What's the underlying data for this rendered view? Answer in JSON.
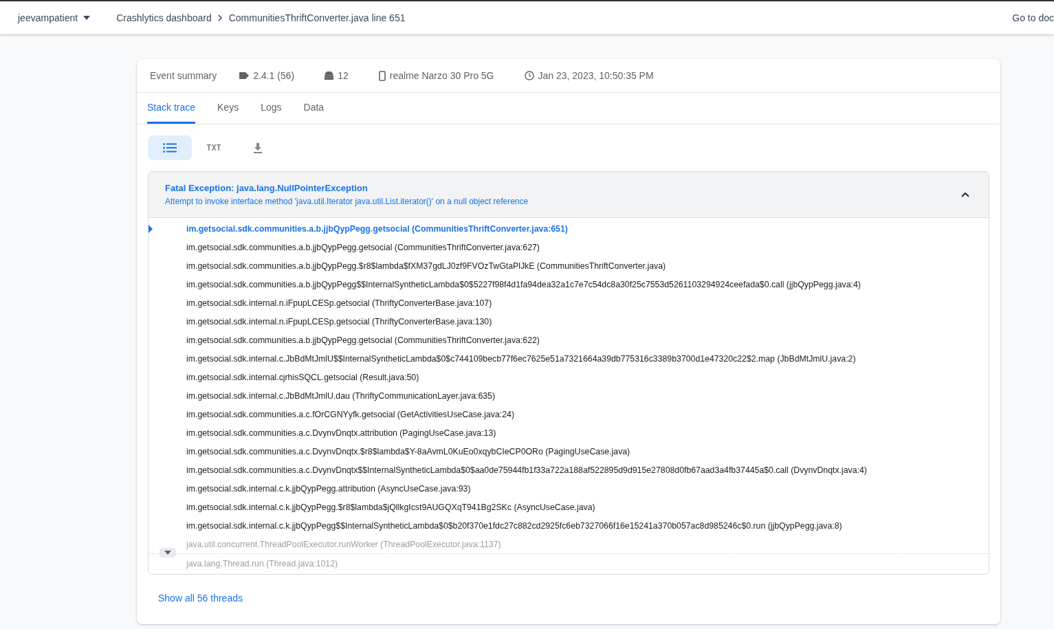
{
  "topbar": {
    "project": "jeevampatient",
    "breadcrumb": [
      "Crashlytics dashboard",
      "CommunitiesThriftConverter.java line 651"
    ],
    "docs_link": "Go to doc"
  },
  "summary": {
    "title": "Event summary",
    "version": "2.4.1 (56)",
    "android": "12",
    "device": "realme Narzo 30 Pro 5G",
    "time": "Jan 23, 2023, 10:50:35 PM"
  },
  "tabs": [
    {
      "label": "Stack trace",
      "selected": true
    },
    {
      "label": "Keys",
      "selected": false
    },
    {
      "label": "Logs",
      "selected": false
    },
    {
      "label": "Data",
      "selected": false
    }
  ],
  "view_options": [
    {
      "kind": "list",
      "selected": true
    },
    {
      "kind": "text",
      "label": "TXT",
      "selected": false
    },
    {
      "kind": "download",
      "selected": false
    }
  ],
  "exception": {
    "title": "Fatal Exception: java.lang.NullPointerException",
    "message": "Attempt to invoke interface method 'java.util.Iterator java.util.List.iterator()' on a null object reference",
    "expanded": true,
    "frames": [
      {
        "kind": "crash",
        "text": "im.getsocial.sdk.communities.a.b.jjbQypPegg.getsocial (CommunitiesThriftConverter.java:651)"
      },
      {
        "kind": "app",
        "text": "im.getsocial.sdk.communities.a.b.jjbQypPegg.getsocial (CommunitiesThriftConverter.java:627)"
      },
      {
        "kind": "app",
        "text": "im.getsocial.sdk.communities.a.b.jjbQypPegg.$r8$lambda$fXM37gdLJ0zf9FVOzTwGtaPlJkE (CommunitiesThriftConverter.java)"
      },
      {
        "kind": "app",
        "text": "im.getsocial.sdk.communities.a.b.jjbQypPegg$$InternalSyntheticLambda$0$5227f98f4d1fa94dea32a1c7e7c54dc8a30f25c7553d5261103294924ceefada$0.call (jjbQypPegg.java:4)"
      },
      {
        "kind": "app",
        "text": "im.getsocial.sdk.internal.n.iFpupLCESp.getsocial (ThriftyConverterBase.java:107)"
      },
      {
        "kind": "app",
        "text": "im.getsocial.sdk.internal.n.iFpupLCESp.getsocial (ThriftyConverterBase.java:130)"
      },
      {
        "kind": "app",
        "text": "im.getsocial.sdk.communities.a.b.jjbQypPegg.getsocial (CommunitiesThriftConverter.java:622)"
      },
      {
        "kind": "app",
        "text": "im.getsocial.sdk.internal.c.JbBdMtJmlU$$InternalSyntheticLambda$0$c744109becb77f6ec7625e51a7321664a39db775316c3389b3700d1e47320c22$2.map (JbBdMtJmlU.java:2)"
      },
      {
        "kind": "app",
        "text": "im.getsocial.sdk.internal.cjrhisSQCL.getsocial (Result.java:50)"
      },
      {
        "kind": "app",
        "text": "im.getsocial.sdk.internal.c.JbBdMtJmlU.dau (ThriftyCommunicationLayer.java:635)"
      },
      {
        "kind": "app",
        "text": "im.getsocial.sdk.communities.a.c.fOrCGNYyfk.getsocial (GetActivitiesUseCase.java:24)"
      },
      {
        "kind": "app",
        "text": "im.getsocial.sdk.communities.a.c.DvynvDnqtx.attribution (PagingUseCase.java:13)"
      },
      {
        "kind": "app",
        "text": "im.getsocial.sdk.communities.a.c.DvynvDnqtx.$r8$lambda$Y-8aAvmL0KuEo0xqybCIeCP0ORo (PagingUseCase.java)"
      },
      {
        "kind": "app",
        "text": "im.getsocial.sdk.communities.a.c.DvynvDnqtx$$InternalSyntheticLambda$0$aa0de75944fb1f33a722a188af522895d9d915e27808d0fb67aad3a4fb37445a$0.call (DvynvDnqtx.java:4)"
      },
      {
        "kind": "app",
        "text": "im.getsocial.sdk.internal.c.k.jjbQypPegg.attribution (AsyncUseCase.java:93)"
      },
      {
        "kind": "app",
        "text": "im.getsocial.sdk.internal.c.k.jjbQypPegg.$r8$lambda$jQllkgIcst9AUGQXqT941Bg2SKc (AsyncUseCase.java)"
      },
      {
        "kind": "app",
        "text": "im.getsocial.sdk.internal.c.k.jjbQypPegg$$InternalSyntheticLambda$0$b20f370e1fdc27c882cd2925fc6eb7327066f16e15241a370b057ac8d985246c$0.run (jjbQypPegg.java:8)"
      },
      {
        "kind": "system",
        "text": "java.util.concurrent.ThreadPoolExecutor.runWorker (ThreadPoolExecutor.java:1137)",
        "fold_after": true
      },
      {
        "kind": "system",
        "text": "java.lang.Thread.run (Thread.java:1012)"
      }
    ]
  },
  "show_threads": "Show all 56 threads"
}
